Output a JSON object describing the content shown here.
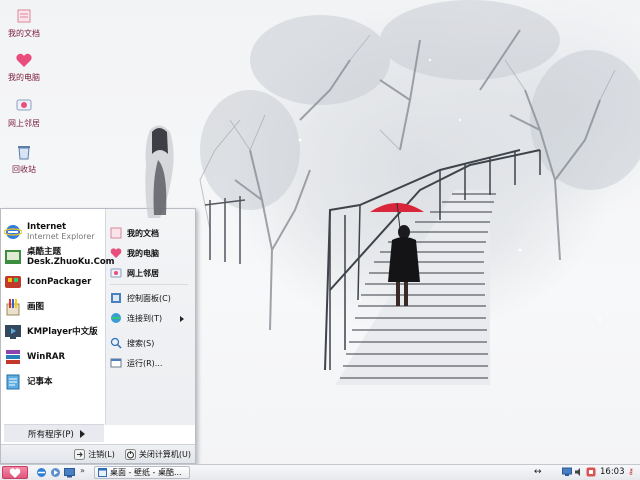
{
  "desktop": {
    "icons": [
      {
        "label": "我的文档",
        "icon": "my-documents-icon"
      },
      {
        "label": "我的电脑",
        "icon": "my-computer-heart-icon"
      },
      {
        "label": "网上邻居",
        "icon": "network-places-icon"
      },
      {
        "label": "回收站",
        "icon": "recycle-bin-icon"
      }
    ]
  },
  "start_menu": {
    "apps": [
      {
        "title": "Internet",
        "subtitle": "Internet Explorer",
        "icon": "internet-explorer-icon"
      },
      {
        "title": "桌酷主题",
        "subtitle": "Desk.ZhuoKu.Com",
        "icon": "zhuoku-theme-icon"
      },
      {
        "title": "IconPackager",
        "icon": "iconpackager-icon"
      },
      {
        "title": "画图",
        "icon": "paint-icon"
      },
      {
        "title": "KMPlayer中文版",
        "icon": "kmplayer-icon"
      },
      {
        "title": "WinRAR",
        "icon": "winrar-icon"
      },
      {
        "title": "记事本",
        "icon": "notepad-icon"
      }
    ],
    "all_programs": "所有程序(P)",
    "places": [
      {
        "label": "我的文档",
        "icon": "my-documents-icon"
      },
      {
        "label": "我的电脑",
        "icon": "my-computer-heart-icon"
      },
      {
        "label": "网上邻居",
        "icon": "network-places-icon"
      },
      {
        "label": "控制面板(C)",
        "icon": "control-panel-icon"
      },
      {
        "label": "连接到(T)",
        "icon": "connect-to-icon"
      },
      {
        "label": "搜索(S)",
        "icon": "search-icon"
      },
      {
        "label": "运行(R)...",
        "icon": "run-icon"
      }
    ],
    "logoff": "注销(L)",
    "shutdown": "关闭计算机(U)"
  },
  "taskbar": {
    "start_icon": "heart-icon",
    "task_button": "桌面 - 壁纸 - 桌酷...",
    "clock": "16:03",
    "colors": {
      "start_pink": "#e0577c",
      "accent": "#7a1d3a"
    }
  }
}
